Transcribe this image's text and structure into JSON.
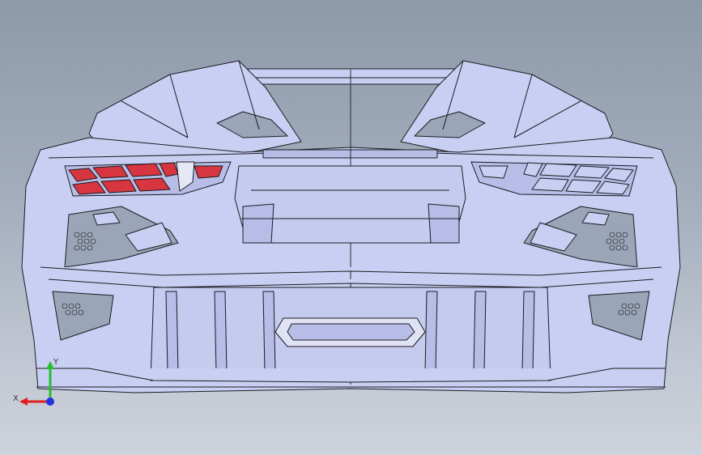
{
  "viewport": {
    "background_top": "#8d9aaa",
    "background_bottom": "#cdd2db",
    "model_fill": "#c9cff2",
    "model_shade": "#b7bde6",
    "edge_color": "#1b1b22",
    "taillight_color": "#d7353f",
    "taillight_dark": "#a8232c"
  },
  "triad": {
    "x_label": "X",
    "y_label": "Y",
    "x_color": "#e0201c",
    "y_color": "#22c02a",
    "z_color": "#2031e0"
  }
}
